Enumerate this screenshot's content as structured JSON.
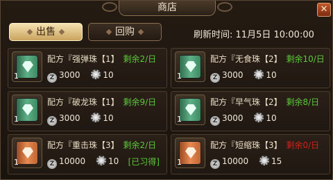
{
  "header": {
    "title": "商店",
    "close_label": "✕"
  },
  "tabs": {
    "sell_label": "出售",
    "buy_label": "回购"
  },
  "refresh": {
    "label": "刷新时间:",
    "value": "11月5日 10:00:00"
  },
  "items": [
    {
      "name": "配方『强弹珠【1】",
      "remaining": "剩余2/日",
      "count": "1",
      "price": "3000",
      "points": "10",
      "book_color": "green",
      "remaining_red": false,
      "learned": ""
    },
    {
      "name": "配方『无食珠【2】",
      "remaining": "剩余10/日",
      "count": "1",
      "price": "3000",
      "points": "10",
      "book_color": "green",
      "remaining_red": false,
      "learned": ""
    },
    {
      "name": "配方『破龙珠【1】",
      "remaining": "剩余9/日",
      "count": "1",
      "price": "3000",
      "points": "10",
      "book_color": "green",
      "remaining_red": false,
      "learned": ""
    },
    {
      "name": "配方『早气珠【2】",
      "remaining": "剩余8/日",
      "count": "1",
      "price": "3000",
      "points": "10",
      "book_color": "green",
      "remaining_red": false,
      "learned": ""
    },
    {
      "name": "配方『重击珠【3】",
      "remaining": "剩余2/日",
      "count": "1",
      "price": "10000",
      "points": "10",
      "book_color": "orange",
      "remaining_red": false,
      "learned": "[已习得]"
    },
    {
      "name": "配方『短缩珠【3】",
      "remaining": "剩余0/日",
      "count": "1",
      "price": "10000",
      "points": "15",
      "book_color": "orange",
      "remaining_red": true,
      "learned": ""
    }
  ]
}
